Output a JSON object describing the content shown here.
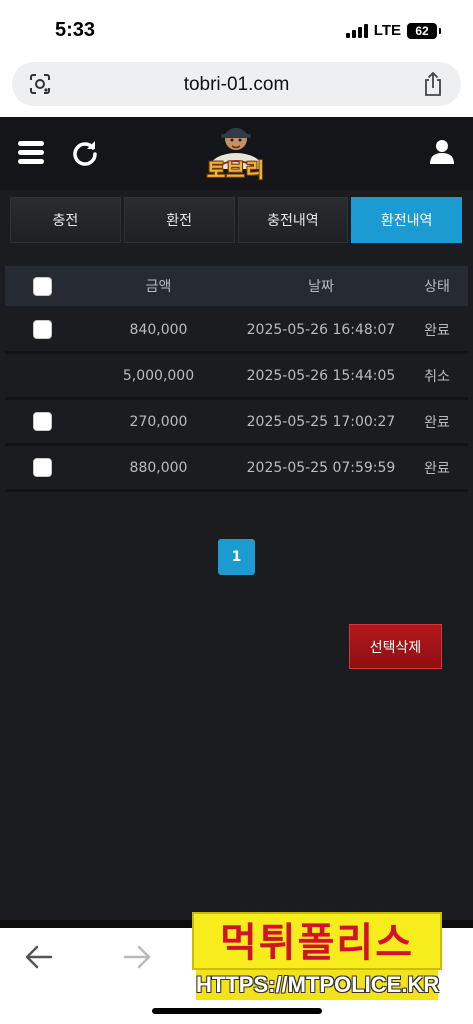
{
  "status_bar": {
    "time": "5:33",
    "network": "LTE",
    "battery": "62"
  },
  "browser": {
    "url": "tobri-01.com"
  },
  "header": {
    "logo_text": "토브리"
  },
  "tabs": [
    {
      "label": "충전",
      "active": false
    },
    {
      "label": "환전",
      "active": false
    },
    {
      "label": "충전내역",
      "active": false
    },
    {
      "label": "환전내역",
      "active": true
    }
  ],
  "table": {
    "headers": {
      "amount": "금액",
      "date": "날짜",
      "status": "상태"
    },
    "rows": [
      {
        "amount": "840,000",
        "date": "2025-05-26 16:48:07",
        "status": "완료",
        "checkbox": true
      },
      {
        "amount": "5,000,000",
        "date": "2025-05-26 15:44:05",
        "status": "취소",
        "checkbox": false
      },
      {
        "amount": "270,000",
        "date": "2025-05-25 17:00:27",
        "status": "완료",
        "checkbox": true
      },
      {
        "amount": "880,000",
        "date": "2025-05-25 07:59:59",
        "status": "완료",
        "checkbox": true
      }
    ]
  },
  "pagination": {
    "current_page": "1"
  },
  "actions": {
    "delete_selected": "선택삭제"
  },
  "watermark": {
    "title": "먹튀폴리스",
    "url": "HTTPS://MTPOLICE.KR"
  },
  "colors": {
    "accent": "#1b9bd1",
    "danger": "#a3141a",
    "background": "#1b1c20"
  }
}
